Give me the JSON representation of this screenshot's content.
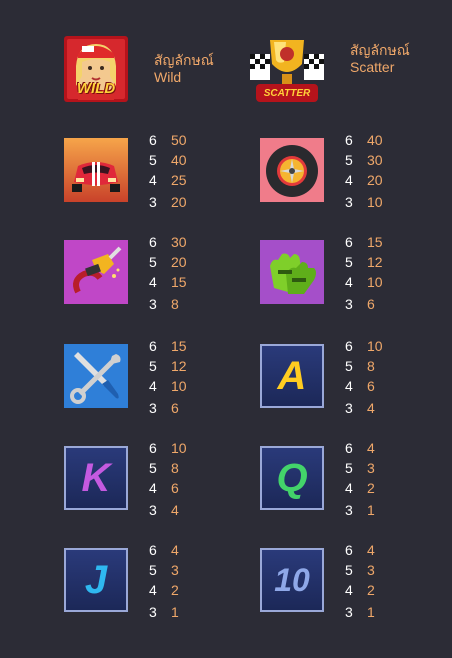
{
  "specials": {
    "wild": {
      "icon": "wild-racer-girl-icon",
      "badge": "WILD",
      "label": "สัญลักษณ์ Wild"
    },
    "scatter": {
      "icon": "scatter-trophy-icon",
      "badge": "SCATTER",
      "label": "สัญลักษณ์ Scatter"
    }
  },
  "symbols": [
    {
      "icon": "race-car-icon",
      "rows": [
        [
          "6",
          "50"
        ],
        [
          "5",
          "40"
        ],
        [
          "4",
          "25"
        ],
        [
          "3",
          "20"
        ]
      ]
    },
    {
      "icon": "tire-icon",
      "rows": [
        [
          "6",
          "40"
        ],
        [
          "5",
          "30"
        ],
        [
          "4",
          "20"
        ],
        [
          "3",
          "10"
        ]
      ]
    },
    {
      "icon": "fuel-nozzle-icon",
      "rows": [
        [
          "6",
          "30"
        ],
        [
          "5",
          "20"
        ],
        [
          "4",
          "15"
        ],
        [
          "3",
          "8"
        ]
      ]
    },
    {
      "icon": "racing-gloves-icon",
      "rows": [
        [
          "6",
          "15"
        ],
        [
          "5",
          "12"
        ],
        [
          "4",
          "10"
        ],
        [
          "3",
          "6"
        ]
      ]
    },
    {
      "icon": "wrench-screwdriver-icon",
      "rows": [
        [
          "6",
          "15"
        ],
        [
          "5",
          "12"
        ],
        [
          "4",
          "10"
        ],
        [
          "3",
          "6"
        ]
      ]
    },
    {
      "icon": "letter-a-icon",
      "letter": "A",
      "rows": [
        [
          "6",
          "10"
        ],
        [
          "5",
          "8"
        ],
        [
          "4",
          "6"
        ],
        [
          "3",
          "4"
        ]
      ]
    },
    {
      "icon": "letter-k-icon",
      "letter": "K",
      "rows": [
        [
          "6",
          "10"
        ],
        [
          "5",
          "8"
        ],
        [
          "4",
          "6"
        ],
        [
          "3",
          "4"
        ]
      ]
    },
    {
      "icon": "letter-q-icon",
      "letter": "Q",
      "rows": [
        [
          "6",
          "4"
        ],
        [
          "5",
          "3"
        ],
        [
          "4",
          "2"
        ],
        [
          "3",
          "1"
        ]
      ]
    },
    {
      "icon": "letter-j-icon",
      "letter": "J",
      "rows": [
        [
          "6",
          "4"
        ],
        [
          "5",
          "3"
        ],
        [
          "4",
          "2"
        ],
        [
          "3",
          "1"
        ]
      ]
    },
    {
      "icon": "number-10-icon",
      "letter": "10",
      "rows": [
        [
          "6",
          "4"
        ],
        [
          "5",
          "3"
        ],
        [
          "4",
          "2"
        ],
        [
          "3",
          "1"
        ]
      ]
    }
  ]
}
